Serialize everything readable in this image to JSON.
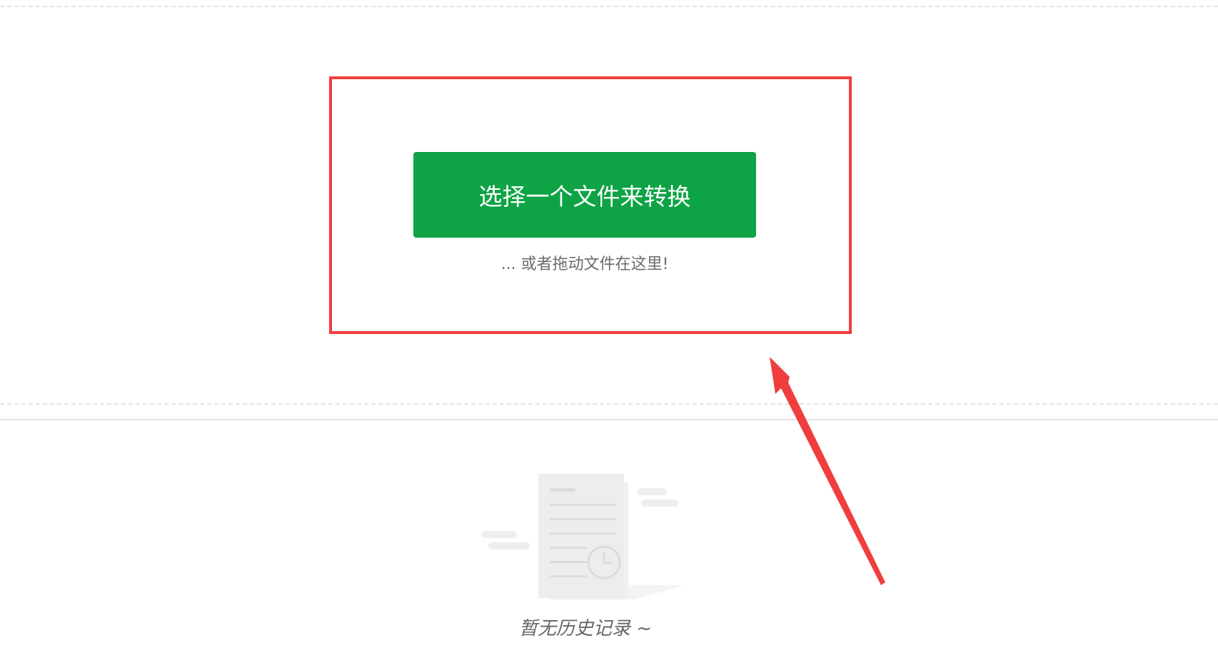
{
  "upload": {
    "button_label": "选择一个文件来转换",
    "drop_hint": "... 或者拖动文件在这里!"
  },
  "history": {
    "empty_text": "暂无历史记录 ~"
  },
  "colors": {
    "button_green": "#0ea345",
    "annotation_red": "#f03e3e"
  },
  "icons": {
    "empty_state": "document-clock-icon",
    "annotation": "arrow-icon"
  }
}
